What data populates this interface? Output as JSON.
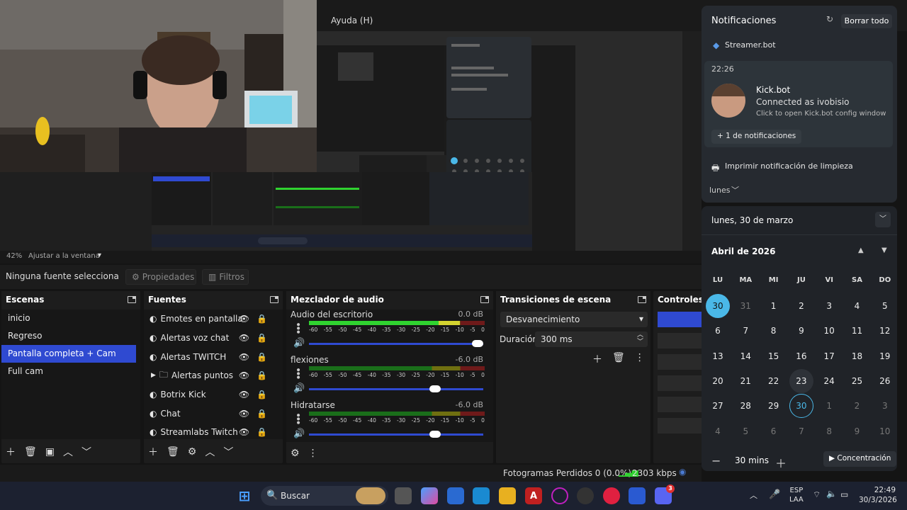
{
  "menubar": {
    "help_label": "Ayuda (H)"
  },
  "preview": {
    "zoom_percent": "42%",
    "zoom_mode": "Ajustar a la ventana"
  },
  "props_row": {
    "no_source": "Ninguna fuente selecciona",
    "properties": "Propiedades",
    "filters": "Filtros"
  },
  "scenes": {
    "title": "Escenas",
    "items": [
      "inicio",
      "Regreso",
      "Pantalla completa + Cam",
      "Full cam"
    ],
    "selected_index": 2
  },
  "sources": {
    "title": "Fuentes",
    "items": [
      "Emotes en pantalla",
      "Alertas voz chat",
      "Alertas TWITCH",
      "Alertas puntos",
      "Botrix Kick",
      "Chat",
      "Streamlabs Twitch"
    ]
  },
  "mixer": {
    "title": "Mezclador de audio",
    "ticks": [
      "-60",
      "-55",
      "-50",
      "-45",
      "-40",
      "-35",
      "-30",
      "-25",
      "-20",
      "-15",
      "-10",
      "-5",
      "0"
    ],
    "channels": [
      {
        "name": "Audio del escritorio",
        "db": "0.0 dB",
        "level": 0.86,
        "volume": 1.0
      },
      {
        "name": "flexiones",
        "db": "-6.0 dB",
        "level": 0.0,
        "volume": 0.74
      },
      {
        "name": "Hidratarse",
        "db": "-6.0 dB",
        "level": 0.0,
        "volume": 0.74
      }
    ]
  },
  "transitions": {
    "title": "Transiciones de escena",
    "selected": "Desvanecimiento",
    "duration_label": "Duración",
    "duration_value": "300 ms"
  },
  "controls": {
    "title": "Controles"
  },
  "status": {
    "frames_lost": "Fotogramas Perdidos 0 (0.0%)",
    "bitrate": "2303 kbps"
  },
  "notifications": {
    "title": "Notificaciones",
    "clear_all": "Borrar todo",
    "app1": "Streamer.bot",
    "time": "22:26",
    "toast_title": "Kick.bot",
    "toast_line1": "Connected as ivobisio",
    "toast_line2": "Click to open Kick.bot config window",
    "more": "+ 1 de notificaciones",
    "app2": "Imprimir notificación de limpieza",
    "day_label": "lunes"
  },
  "calendar": {
    "date_header": "lunes, 30 de marzo",
    "month": "Abril de 2026",
    "weekdays": [
      "LU",
      "MA",
      "MI",
      "JU",
      "VI",
      "SA",
      "DO"
    ],
    "weeks": [
      [
        "30",
        "31",
        "1",
        "2",
        "3",
        "4",
        "5"
      ],
      [
        "6",
        "7",
        "8",
        "9",
        "10",
        "11",
        "12"
      ],
      [
        "13",
        "14",
        "15",
        "16",
        "17",
        "18",
        "19"
      ],
      [
        "20",
        "21",
        "22",
        "23",
        "24",
        "25",
        "26"
      ],
      [
        "27",
        "28",
        "29",
        "30",
        "1",
        "2",
        "3"
      ],
      [
        "4",
        "5",
        "6",
        "7",
        "8",
        "9",
        "10"
      ]
    ],
    "focus_minutes": "30 mins",
    "focus_label": "Concentración"
  },
  "taskbar": {
    "search": "Buscar",
    "lang1": "ESP",
    "lang2": "LAA",
    "time": "22:49",
    "date": "30/3/2026",
    "discord_badge": "3"
  },
  "colors": {
    "accent": "#2f4ad1",
    "today": "#4ab8e8"
  }
}
